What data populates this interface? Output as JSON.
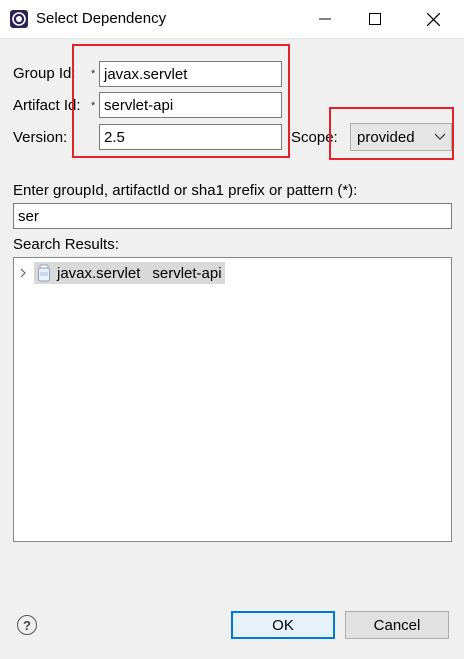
{
  "window": {
    "title": "Select Dependency",
    "icons": {
      "app": "eclipse-icon",
      "minimize": "minimize-icon",
      "maximize": "maximize-icon",
      "close": "close-icon"
    }
  },
  "form": {
    "group_id_label": "Group Id:",
    "group_id_required": "*",
    "group_id_value": "javax.servlet",
    "artifact_id_label": "Artifact Id:",
    "artifact_id_required": "*",
    "artifact_id_value": "servlet-api",
    "version_label": "Version:",
    "version_value": "2.5",
    "scope_label": "Scope:",
    "scope_value": "provided"
  },
  "search": {
    "prompt": "Enter groupId, artifactId or sha1 prefix or pattern (*):",
    "value": "ser",
    "results_label": "Search Results:",
    "results": [
      {
        "group": "javax.servlet",
        "artifact": "servlet-api",
        "icon": "jar-icon"
      }
    ]
  },
  "buttons": {
    "ok": "OK",
    "cancel": "Cancel",
    "help": "?"
  },
  "colors": {
    "highlight_box": "#e2232a",
    "ok_border": "#0078d7",
    "selection": "#d9d9d9"
  }
}
